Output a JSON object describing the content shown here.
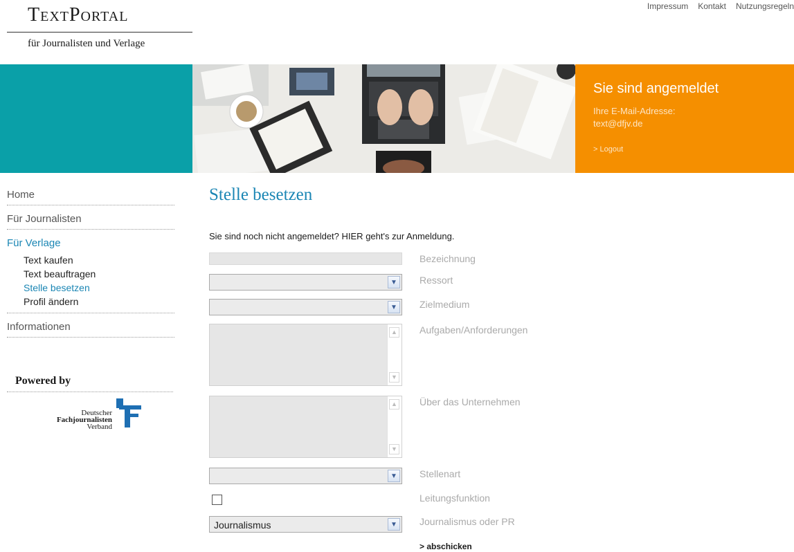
{
  "header": {
    "logo_title": "TextPortal",
    "logo_subtitle": "für Journalisten und Verlage",
    "topnav": [
      "Impressum",
      "Kontakt",
      "Nutzungsregeln"
    ]
  },
  "banner": {
    "status_title": "Sie sind angemeldet",
    "email_label": "Ihre E-Mail-Adresse:",
    "email": "text@dfjv.de",
    "logout": "> Logout"
  },
  "sidebar": {
    "items": [
      {
        "label": "Home"
      },
      {
        "label": "Für Journalisten"
      },
      {
        "label": "Für Verlage"
      },
      {
        "label": "Informationen"
      }
    ],
    "subitems": [
      {
        "label": "Text kaufen"
      },
      {
        "label": "Text beauftragen"
      },
      {
        "label": "Stelle besetzen"
      },
      {
        "label": "Profil ändern"
      }
    ],
    "powered_by": "Powered by",
    "dfjv_line1": "Deutscher",
    "dfjv_line2": "Fachjournalisten",
    "dfjv_line3": "Verband"
  },
  "main": {
    "title": "Stelle besetzen",
    "notice_pre": "Sie sind noch nicht angemeldet? ",
    "notice_link": "HIER",
    "notice_post": " geht's zur Anmeldung.",
    "fields": {
      "bezeichnung": {
        "label": "Bezeichnung",
        "value": ""
      },
      "ressort": {
        "label": "Ressort",
        "value": ""
      },
      "zielmedium": {
        "label": "Zielmedium",
        "value": ""
      },
      "aufgaben": {
        "label": "Aufgaben/Anforderungen",
        "value": ""
      },
      "unternehmen": {
        "label": "Über das Unternehmen",
        "value": ""
      },
      "stellenart": {
        "label": "Stellenart",
        "value": ""
      },
      "leitung": {
        "label": "Leitungsfunktion",
        "checked": false
      },
      "journalismus": {
        "label": "Journalismus oder PR",
        "value": "Journalismus"
      }
    },
    "submit": "> abschicken"
  },
  "colors": {
    "teal": "#0aa0a8",
    "orange": "#f58f00",
    "link_blue": "#1b86b4"
  },
  "icons": [
    "chevron-down-icon",
    "scroll-up-icon",
    "scroll-down-icon",
    "dfjv-logo-icon"
  ]
}
